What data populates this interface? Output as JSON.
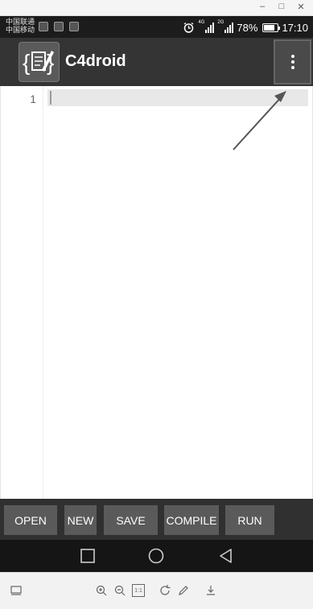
{
  "window": {
    "minimize": "–",
    "maximize": "□",
    "close": "✕"
  },
  "status_bar": {
    "carrier_1": "中国联通",
    "carrier_2": "中国移动",
    "sim1_network": "4G",
    "sim2_network": "2G",
    "battery_percent": "78%",
    "battery_level": 0.78,
    "time": "17:10",
    "icons": [
      "app-notification-icon",
      "app-notification-icon",
      "image-notification-icon",
      "alarm-clock-icon",
      "signal-icon",
      "signal-icon",
      "battery-icon"
    ]
  },
  "app_bar": {
    "title": "C4droid",
    "overflow_icon": "more-vert-icon"
  },
  "editor": {
    "line_numbers": [
      "1"
    ]
  },
  "toolbar": {
    "open": "OPEN",
    "new": "NEW",
    "save": "SAVE",
    "compile": "COMPILE",
    "run": "RUN"
  },
  "nav_bar": {
    "icons": [
      "recents-square-icon",
      "home-circle-icon",
      "back-triangle-icon"
    ]
  },
  "host_toolbar": {
    "icons": [
      "screen-icon",
      "zoom-in-icon",
      "zoom-out-icon",
      "actual-size-icon",
      "rotate-icon",
      "pen-icon",
      "download-icon"
    ],
    "actual_size_label": "1:1"
  },
  "colors": {
    "app_bar": "#343434",
    "button": "#5a5a5a",
    "toolbar": "#303030",
    "status_bar": "#1c1c1c"
  }
}
